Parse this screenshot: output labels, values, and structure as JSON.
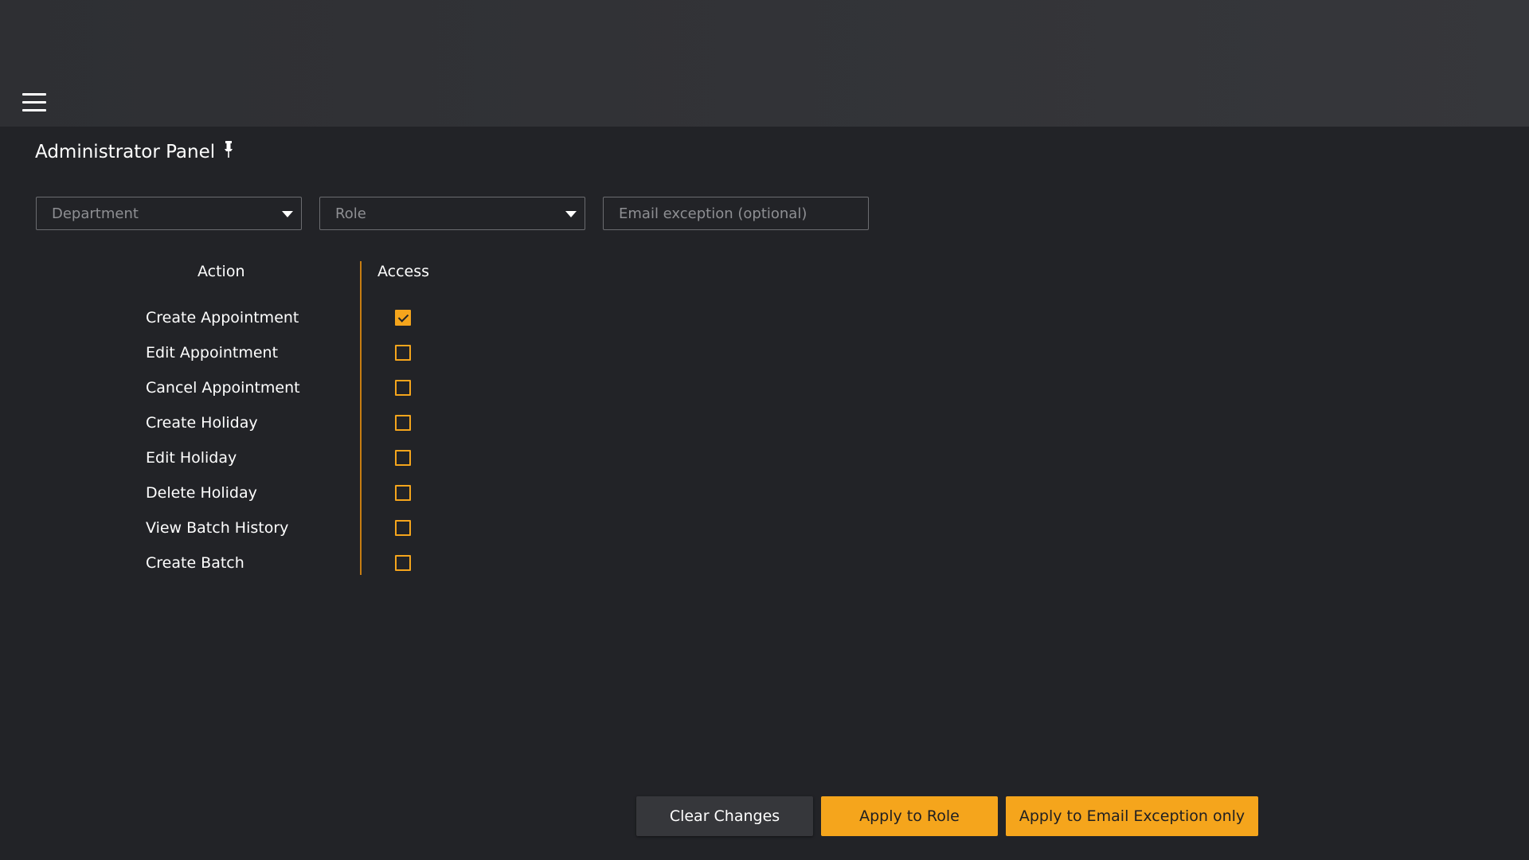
{
  "header": {
    "menu_icon": "hamburger-menu-icon"
  },
  "page": {
    "title": "Administrator Panel",
    "pin_icon": "pushpin-icon"
  },
  "filters": {
    "department_placeholder": "Department",
    "role_placeholder": "Role",
    "email_placeholder": "Email exception (optional)"
  },
  "colors": {
    "accent": "#f5a51c",
    "background": "#222327",
    "topbar": "#36373b"
  },
  "table": {
    "action_header": "Action",
    "access_header": "Access",
    "rows": [
      {
        "label": "Create Appointment",
        "checked": true
      },
      {
        "label": "Edit Appointment",
        "checked": false
      },
      {
        "label": "Cancel Appointment",
        "checked": false
      },
      {
        "label": "Create Holiday",
        "checked": false
      },
      {
        "label": "Edit Holiday",
        "checked": false
      },
      {
        "label": "Delete Holiday",
        "checked": false
      },
      {
        "label": "View Batch History",
        "checked": false
      },
      {
        "label": "Create Batch",
        "checked": false
      }
    ]
  },
  "actions": {
    "clear_label": "Clear Changes",
    "apply_role_label": "Apply to Role",
    "apply_email_label": "Apply to Email Exception only"
  }
}
